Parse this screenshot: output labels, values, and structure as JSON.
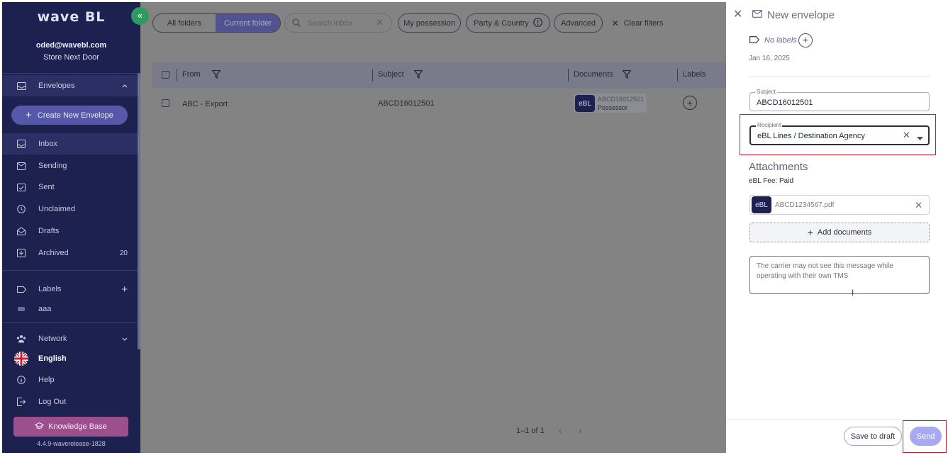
{
  "sidebar": {
    "logo": "wave BL",
    "user_email": "oded@wavebl.com",
    "user_store": "Store Next Door",
    "envelopes_label": "Envelopes",
    "create_label": "Create New Envelope",
    "nav": [
      {
        "label": "Inbox",
        "icon": "inbox-icon"
      },
      {
        "label": "Sending",
        "icon": "sending-icon"
      },
      {
        "label": "Sent",
        "icon": "sent-icon"
      },
      {
        "label": "Unclaimed",
        "icon": "clock-icon"
      },
      {
        "label": "Drafts",
        "icon": "drafts-icon"
      },
      {
        "label": "Archived",
        "icon": "archive-icon",
        "count": "20"
      }
    ],
    "labels_title": "Labels",
    "label_items": [
      "aaa"
    ],
    "network_label": "Network",
    "language_label": "English",
    "help_label": "Help",
    "logout_label": "Log Out",
    "kb_label": "Knowledge Base",
    "version": "4.4.9-waverelease-1828"
  },
  "toolbar": {
    "all_folders": "All folders",
    "current_folder": "Current folder",
    "search_placeholder": "Search inbox",
    "my_possession": "My possession",
    "party_country": "Party & Country",
    "advanced": "Advanced",
    "clear_filters": "Clear filters"
  },
  "table": {
    "columns": [
      "From",
      "Subject",
      "Documents",
      "Labels"
    ],
    "rows": [
      {
        "from": "ABC - Export",
        "subject": "ABCD16012501",
        "doc_badge": "eBL",
        "doc_number": "ABCD16012501",
        "doc_role": "Possessor"
      }
    ],
    "pagination": "1–1 of 1"
  },
  "drawer": {
    "title": "New envelope",
    "no_labels": "No labels",
    "date": "Jan 16, 2025",
    "subject_label": "Subject",
    "subject_value": "ABCD16012501",
    "recipient_label": "Recipient",
    "recipient_value": "eBL Lines / Destination Agency",
    "attachments_title": "Attachments",
    "fee": "eBL Fee: Paid",
    "file_badge": "eBL",
    "file_name": "ABCD1234567.pdf",
    "add_documents": "Add documents",
    "message_placeholder": "The carrier may not see this message while operating with their own TMS",
    "save_draft": "Save to draft",
    "send": "Send"
  },
  "colors": {
    "sidebar_bg": "#1d2150",
    "accent_green": "#2e9a62",
    "create_btn": "#5558a8",
    "kb_btn": "#9c4f8d",
    "highlight_red": "#d01c2a",
    "send_btn": "#a7aaf0"
  }
}
